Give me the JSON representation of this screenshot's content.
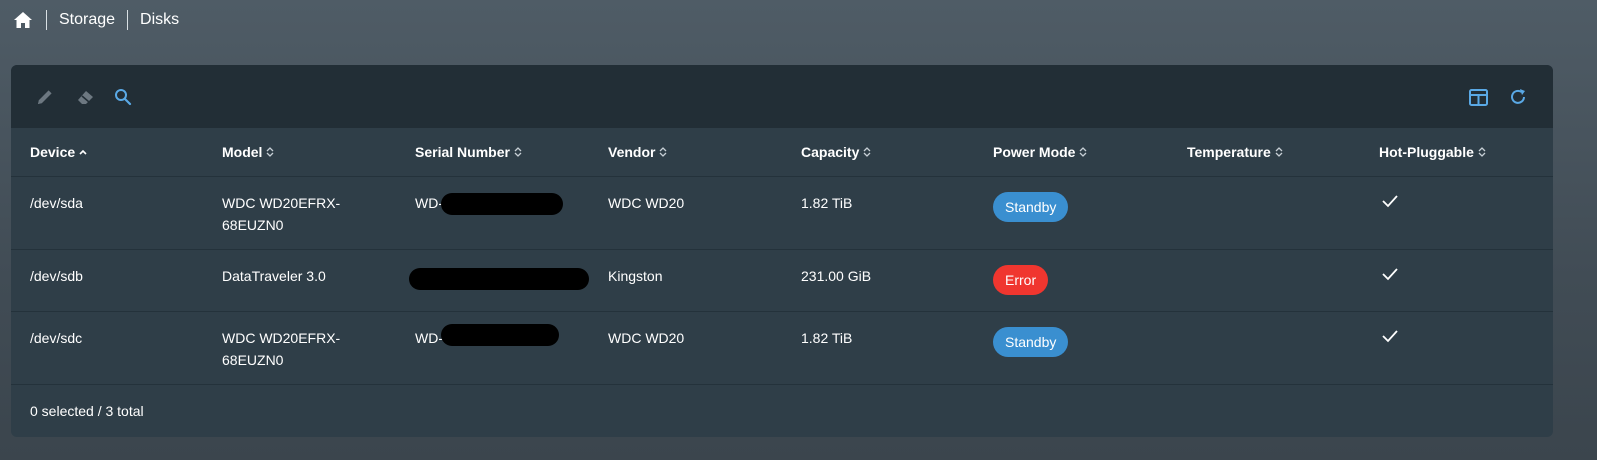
{
  "breadcrumb": {
    "items": [
      "Storage",
      "Disks"
    ]
  },
  "toolbar": {
    "edit_icon": "pencil-icon",
    "wipe_icon": "eraser-icon",
    "search_icon": "search-icon",
    "columns_icon": "table-columns-icon",
    "refresh_icon": "refresh-icon"
  },
  "table": {
    "columns": [
      "Device",
      "Model",
      "Serial Number",
      "Vendor",
      "Capacity",
      "Power Mode",
      "Temperature",
      "Hot-Pluggable"
    ],
    "sorted_column": "Device",
    "rows": [
      {
        "device": "/dev/sda",
        "model_line1": "WDC WD20EFRX-",
        "model_line2": "68EUZN0",
        "serial": "WD-",
        "vendor": "WDC WD20",
        "capacity": "1.82 TiB",
        "power_mode": "Standby",
        "temperature": "",
        "hot_pluggable": "✓"
      },
      {
        "device": "/dev/sdb",
        "model_line1": "DataTraveler 3.0",
        "model_line2": "",
        "serial": "",
        "vendor": "Kingston",
        "capacity": "231.00 GiB",
        "power_mode": "Error",
        "temperature": "",
        "hot_pluggable": "✓"
      },
      {
        "device": "/dev/sdc",
        "model_line1": "WDC WD20EFRX-",
        "model_line2": "68EUZN0",
        "serial": "WD-",
        "vendor": "WDC WD20",
        "capacity": "1.82 TiB",
        "power_mode": "Standby",
        "temperature": "",
        "hot_pluggable": "✓"
      }
    ]
  },
  "footer": {
    "summary": "0 selected / 3 total"
  },
  "colors": {
    "standby": "#3a8fd0",
    "error": "#f0362f",
    "accent_icon": "#5aa9e6"
  }
}
